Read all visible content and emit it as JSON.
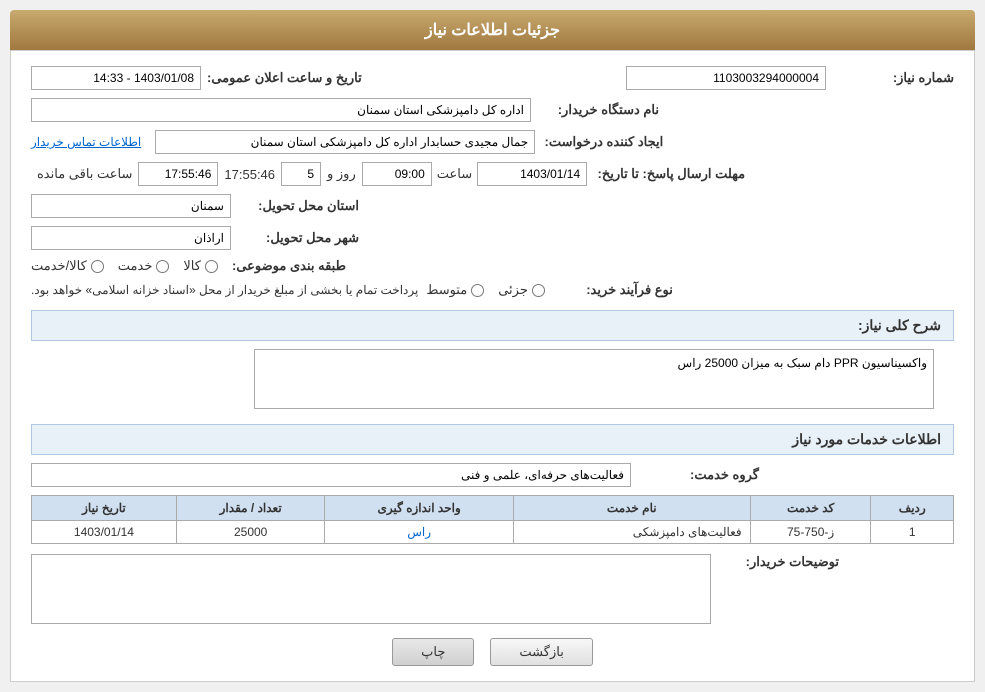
{
  "header": {
    "title": "جزئیات اطلاعات نیاز"
  },
  "fields": {
    "shomara_niaz_label": "شماره نیاز:",
    "shomara_niaz_value": "1103003294000004",
    "name_dastgah_label": "نام دستگاه خریدار:",
    "name_dastgah_value": "اداره کل دامپزشکی استان سمنان",
    "ijad_konande_label": "ایجاد کننده درخواست:",
    "ijad_konande_value": "جمال مجیدی حسابدار اداره کل دامپزشکی استان سمنان",
    "ettelaat_tamas_label": "اطلاعات تماس خریدار",
    "mohlat_label": "مهلت ارسال پاسخ: تا تاریخ:",
    "date_value": "1403/01/14",
    "saat_label": "ساعت",
    "saat_value": "09:00",
    "roz_label": "روز و",
    "roz_value": "5",
    "baqi_saat_value": "17:55:46",
    "baqi_label": "ساعت باقی مانده",
    "ostan_label": "استان محل تحویل:",
    "ostan_value": "سمنان",
    "shahr_label": "شهر محل تحویل:",
    "shahr_value": "اراذان",
    "tabaqe_label": "طبقه بندی موضوعی:",
    "kala_label": "کالا",
    "khedmat_label": "خدمت",
    "kala_khedmat_label": "کالا/خدمت",
    "noue_farayand_label": "نوع فرآیند خرید:",
    "jozei_label": "جزئی",
    "motovaset_label": "متوسط",
    "notice": "پرداخت تمام یا بخشی از مبلغ خریدار از محل «اسناد خزانه اسلامی» خواهد بود.",
    "sharh_label": "شرح کلی نیاز:",
    "sharh_value": "واکسیناسیون PPR دام سبک به میزان 25000 راس",
    "khadamat_label": "اطلاعات خدمات مورد نیاز",
    "grooh_label": "گروه خدمت:",
    "grooh_value": "فعالیت‌های حرفه‌ای، علمی و فنی",
    "table": {
      "headers": [
        "ردیف",
        "کد خدمت",
        "نام خدمت",
        "واحد اندازه گیری",
        "تعداد / مقدار",
        "تاریخ نیاز"
      ],
      "rows": [
        {
          "radif": "1",
          "kod": "ز-750-75",
          "nam": "فعالیت‌های دامپزشکی",
          "vahed": "راس",
          "tedad": "25000",
          "tarikh": "1403/01/14"
        }
      ]
    },
    "tosif_label": "توضیحات خریدار:",
    "tosif_value": "",
    "tarikh_aalan_label": "تاریخ و ساعت اعلان عمومی:",
    "tarikh_aalan_value": "1403/01/08 - 14:33"
  },
  "buttons": {
    "print": "چاپ",
    "back": "بازگشت"
  }
}
